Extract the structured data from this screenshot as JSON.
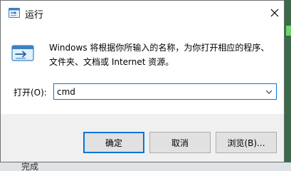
{
  "window": {
    "title": "运行"
  },
  "dialog": {
    "description": "Windows 将根据你所输入的名称，为你打开相应的程序、文件夹、文档或 Internet 资源。",
    "open_label": "打开(O):",
    "input_value": "cmd"
  },
  "buttons": {
    "ok": "确定",
    "cancel": "取消",
    "browse": "浏览(B)..."
  },
  "background": {
    "partial_text": "完成"
  },
  "icons": {
    "title": "run-icon",
    "main": "run-icon",
    "close": "close-icon",
    "dropdown": "chevron-down-icon"
  },
  "colors": {
    "accent": "#0078d7",
    "window_bg": "#f0f0f0",
    "body_bg": "#ffffff"
  }
}
